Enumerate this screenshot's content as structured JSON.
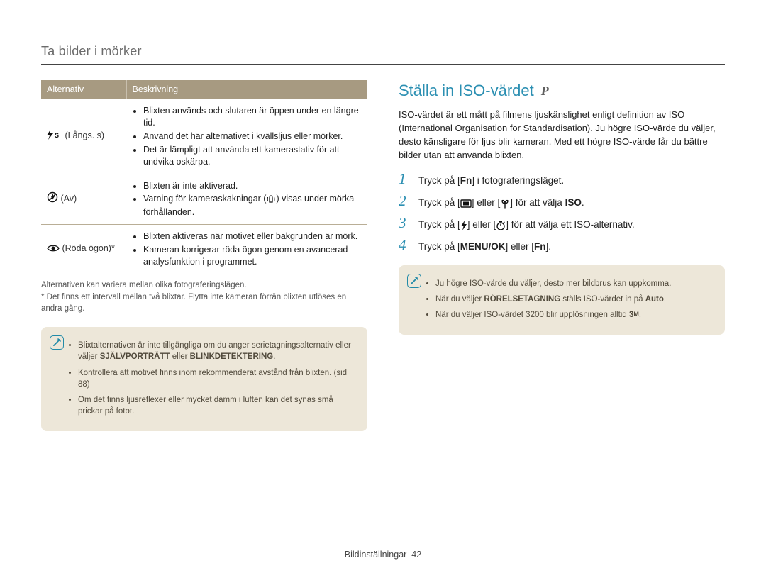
{
  "header": "Ta bilder i mörker",
  "table": {
    "head": {
      "alt": "Alternativ",
      "desc": "Beskrivning"
    },
    "rows": [
      {
        "alt_icon": "flash-slow-icon",
        "alt_label": "(Långs. s)",
        "desc": [
          "Blixten används och slutaren är öppen under en längre tid.",
          "Använd det här alternativet i kvällsljus eller mörker.",
          "Det är lämpligt att använda ett kamerastativ för att undvika oskärpa."
        ]
      },
      {
        "alt_icon": "flash-off-icon",
        "alt_label": "(Av)",
        "desc": [
          "Blixten är inte aktiverad.",
          "Varning för kameraskakningar ( ) visas under mörka förhållanden."
        ]
      },
      {
        "alt_icon": "red-eye-icon",
        "alt_label": "(Röda ögon)*",
        "desc": [
          "Blixten aktiveras när motivet eller bakgrunden är mörk.",
          "Kameran korrigerar röda ögon genom en avancerad analysfunktion i programmet."
        ]
      }
    ]
  },
  "footnotes": {
    "f1": "Alternativen kan variera mellan olika fotograferingslägen.",
    "f2": "* Det finns ett intervall mellan två blixtar. Flytta inte kameran förrän blixten utlöses en andra gång."
  },
  "left_note": {
    "items": [
      {
        "pre": "Blixtalternativen är inte tillgängliga om du anger serietagningsalternativ eller väljer ",
        "b1": "SJÄLVPORTRÄTT",
        "mid": " eller ",
        "b2": "BLINKDETEKTERING",
        "post": "."
      },
      {
        "text": "Kontrollera att motivet finns inom rekommenderat avstånd från blixten. (sid 88)"
      },
      {
        "text": "Om det finns ljusreflexer eller mycket damm i luften kan det synas små prickar på fotot."
      }
    ]
  },
  "right": {
    "heading": "Ställa in ISO-värdet",
    "mode": "P",
    "intro": "ISO-värdet är ett mått på filmens ljuskänslighet enligt definition av ISO (International Organisation for Standardisation). Ju högre ISO-värde du väljer, desto känsligare för ljus blir kameran. Med ett högre ISO-värde får du bättre bilder utan att använda blixten.",
    "steps": {
      "s1": {
        "pre": "Tryck på [",
        "b1": "Fn",
        "post": "] i fotograferingsläget."
      },
      "s2": {
        "pre": "Tryck på [",
        "mid": "] eller [",
        "post": "] för att välja ",
        "b1": "ISO",
        "tail": "."
      },
      "s3": {
        "pre": "Tryck på [",
        "mid": "] eller [",
        "post": "] för att välja ett ISO-alternativ."
      },
      "s4": {
        "pre": "Tryck på [",
        "b1": "MENU/OK",
        "mid": "] eller [",
        "b2": "Fn",
        "post": "]."
      }
    },
    "note": {
      "i1": "Ju högre ISO-värde du väljer, desto mer bildbrus kan uppkomma.",
      "i2_pre": "När du väljer ",
      "i2_b1": "RÖRELSETAGNING",
      "i2_mid": " ställs ISO-värdet in på ",
      "i2_b2": "Auto",
      "i2_post": ".",
      "i3_pre": "När du väljer ISO-värdet 3200 blir upplösningen alltid ",
      "i3_b": "3",
      "i3_unit": "M",
      "i3_post": "."
    }
  },
  "footer": {
    "section": "Bildinställningar",
    "page": "42"
  }
}
